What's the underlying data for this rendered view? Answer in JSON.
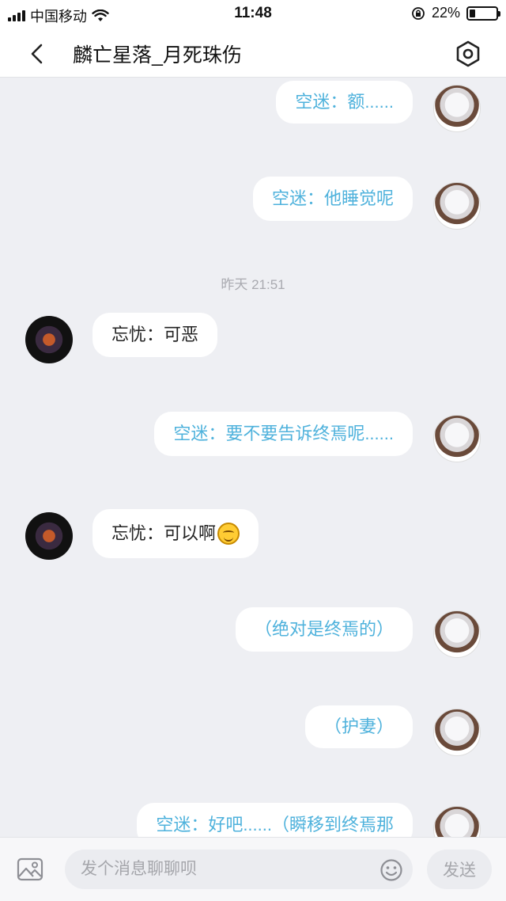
{
  "status_bar": {
    "carrier": "中国移动",
    "time": "11:48",
    "battery_percent": "22%",
    "battery_level": 0.22
  },
  "header": {
    "title": "麟亡星落_月死珠伤"
  },
  "messages": [
    {
      "side": "out",
      "text": "空迷：额......"
    },
    {
      "side": "out",
      "text": "空迷：他睡觉呢"
    },
    {
      "side": "in",
      "text": "忘忧：可恶"
    },
    {
      "side": "out",
      "text": "空迷：要不要告诉终焉呢......"
    },
    {
      "side": "in",
      "text": "忘忧：可以啊"
    },
    {
      "side": "out",
      "text": "（绝对是终焉的）"
    },
    {
      "side": "out",
      "text": "（护妻）"
    },
    {
      "side": "out",
      "text": "空迷：好吧......（瞬移到终焉那"
    }
  ],
  "timestamp": "昨天 21:51",
  "input": {
    "placeholder": "发个消息聊聊呗",
    "send_label": "发送"
  },
  "colors": {
    "outgoing_text": "#4fb2dc",
    "background": "#eeeff3"
  }
}
